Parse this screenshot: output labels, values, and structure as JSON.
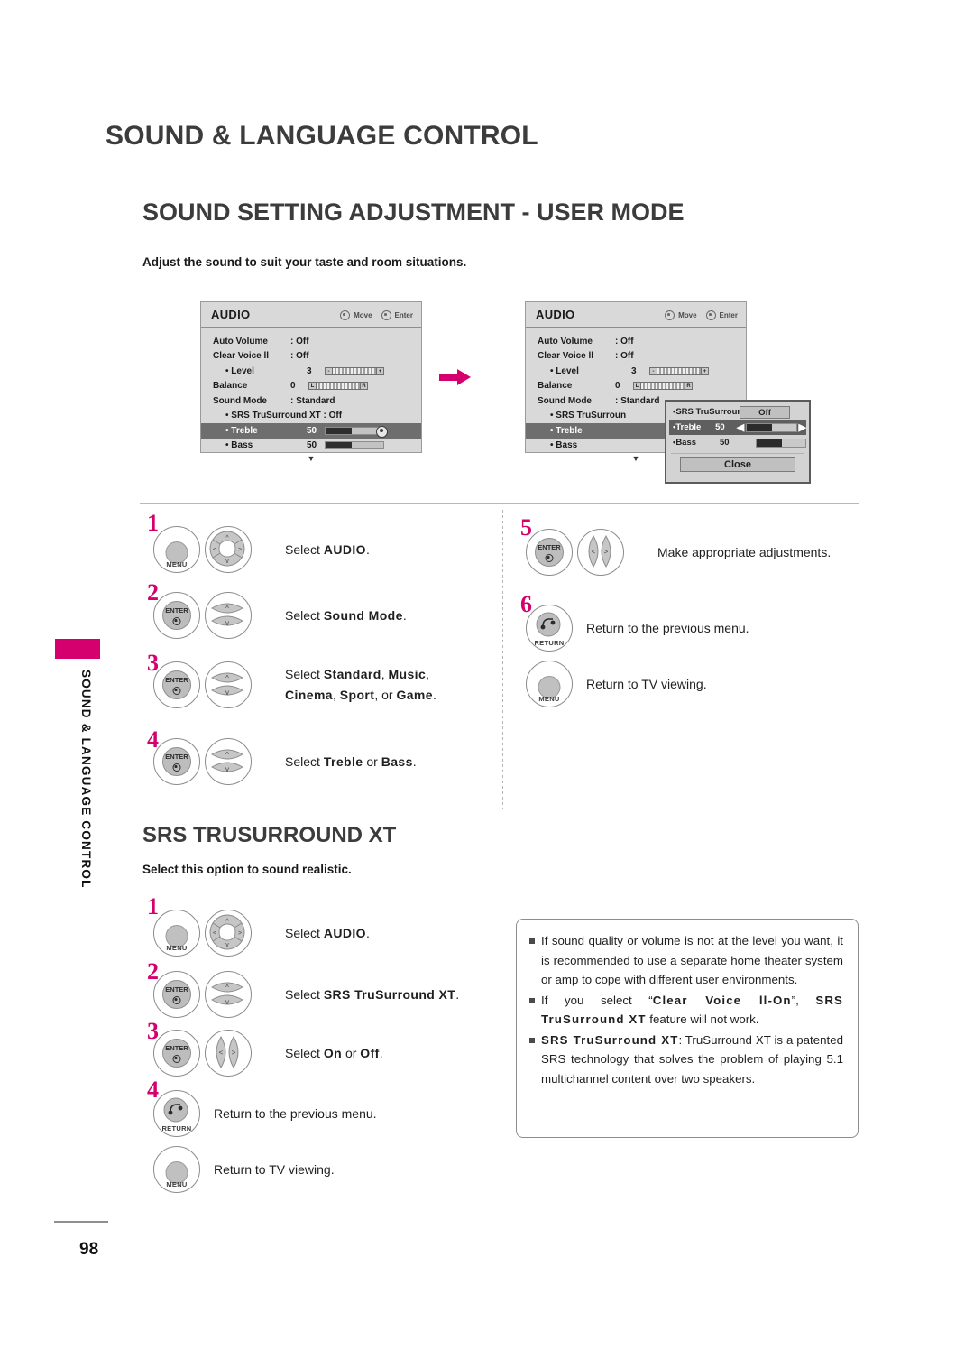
{
  "document": {
    "chapter_title": "SOUND & LANGUAGE CONTROL",
    "section_title": "SOUND SETTING ADJUSTMENT - USER MODE",
    "section_intro": "Adjust the sound to suit your taste and room situations.",
    "side_tab_label": "SOUND & LANGUAGE CONTROL",
    "page_number": "98"
  },
  "osd_menu_1": {
    "title": "AUDIO",
    "hint_move": "Move",
    "hint_enter": "Enter",
    "rows": [
      {
        "label": "Auto Volume",
        "value": ": Off"
      },
      {
        "label": "Clear Voice ll",
        "value": ": Off"
      },
      {
        "label": "• Level",
        "number": "3",
        "widget": "segments-level"
      },
      {
        "label": "Balance",
        "number": "0",
        "widget": "segments-balance"
      },
      {
        "label": "Sound Mode",
        "value": ": Standard"
      },
      {
        "label": "• SRS TruSurround XT : Off"
      },
      {
        "label": "• Treble",
        "number": "50",
        "widget": "bar-knob",
        "selected": true
      },
      {
        "label": "• Bass",
        "number": "50",
        "widget": "bar"
      }
    ],
    "level_caps": {
      "left": "-",
      "right": "+"
    },
    "balance_caps": {
      "left": "L",
      "right": "R"
    },
    "scroll_indicator": "▼"
  },
  "osd_menu_2": {
    "title": "AUDIO",
    "hint_move": "Move",
    "hint_enter": "Enter",
    "rows": [
      {
        "label": "Auto Volume",
        "value": ": Off"
      },
      {
        "label": "Clear Voice ll",
        "value": ": Off"
      },
      {
        "label": "• Level",
        "number": "3",
        "widget": "segments-level"
      },
      {
        "label": "Balance",
        "number": "0",
        "widget": "segments-balance"
      },
      {
        "label": "Sound Mode",
        "value": ": Standard"
      },
      {
        "label": "• SRS TruSurroun"
      },
      {
        "label": "• Treble",
        "selected": true
      },
      {
        "label": "• Bass"
      }
    ],
    "level_caps": {
      "left": "-",
      "right": "+"
    },
    "balance_caps": {
      "left": "L",
      "right": "R"
    },
    "scroll_indicator": "▼"
  },
  "osd_popup": {
    "rows": [
      {
        "label": "•SRS TruSurround XT",
        "button": "Off"
      },
      {
        "label": "•Treble",
        "number": "50",
        "left_arrow": "◀",
        "right_arrow": "▶",
        "selected": true
      },
      {
        "label": "•Bass",
        "number": "50"
      }
    ],
    "close_label": "Close"
  },
  "steps_user_mode_left": [
    {
      "num": "1",
      "buttons": [
        "menu",
        "wheel"
      ],
      "text_html": "Select <b>AUDIO</b>."
    },
    {
      "num": "2",
      "buttons": [
        "enter",
        "updown"
      ],
      "text_html": "Select <b class=\"sp\">Sound Mode</b>."
    },
    {
      "num": "3",
      "buttons": [
        "enter",
        "updown"
      ],
      "text_html": "Select <b class=\"sp\">Standard</b>, <b class=\"sp\">Music</b>,<br><b class=\"sp\">Cinema</b>, <b class=\"sp\">Sport</b>, or <b class=\"sp\">Game</b>."
    },
    {
      "num": "4",
      "buttons": [
        "enter",
        "updown"
      ],
      "text_html": "Select <b class=\"sp\">Treble</b> or <b class=\"sp\">Bass</b>."
    }
  ],
  "steps_user_mode_right": [
    {
      "num": "5",
      "buttons": [
        "enter",
        "leftright"
      ],
      "text_html": "Make appropriate adjustments."
    },
    {
      "num": "6",
      "buttons": [
        "return"
      ],
      "text_html": "Return to the previous menu."
    },
    {
      "num": "",
      "buttons": [
        "menu"
      ],
      "text_html": "Return to TV viewing."
    }
  ],
  "srs_section": {
    "title": "SRS TRUSURROUND XT",
    "intro": "Select this option to sound realistic.",
    "steps": [
      {
        "num": "1",
        "buttons": [
          "menu",
          "wheel"
        ],
        "text_html": "Select <b>AUDIO</b>."
      },
      {
        "num": "2",
        "buttons": [
          "enter",
          "updown"
        ],
        "text_html": "Select <b class=\"sp\">SRS TruSurround XT</b>."
      },
      {
        "num": "3",
        "buttons": [
          "enter",
          "leftright"
        ],
        "text_html": "Select <b class=\"sp\">On</b> or <b class=\"sp\">Off</b>."
      },
      {
        "num": "4",
        "buttons": [
          "return"
        ],
        "text_html": "Return to the previous menu."
      },
      {
        "num": "",
        "buttons": [
          "menu"
        ],
        "text_html": "Return to TV viewing."
      }
    ]
  },
  "note_box": {
    "items": [
      "If sound quality or volume is not at the level you want, it is recommended to use a separate home theater system or amp to cope with different user environments.",
      "If you select &ldquo;<b class=\"sp\">Clear Voice ll-On</b>&rdquo;, <b class=\"sp\">SRS TruSurround XT</b> feature will not work.",
      "<b class=\"sp\">SRS TruSurround XT</b>: TruSurround XT is a patented SRS technology that solves the problem of playing 5.1 multichannel content over two speakers."
    ]
  },
  "button_labels": {
    "menu": "MENU",
    "enter": "ENTER",
    "return": "RETURN"
  },
  "colors": {
    "accent": "#d5006d",
    "heading": "#3c3c3c",
    "osd_bg": "#d9d9d9",
    "osd_selected": "#6e6e6e"
  }
}
